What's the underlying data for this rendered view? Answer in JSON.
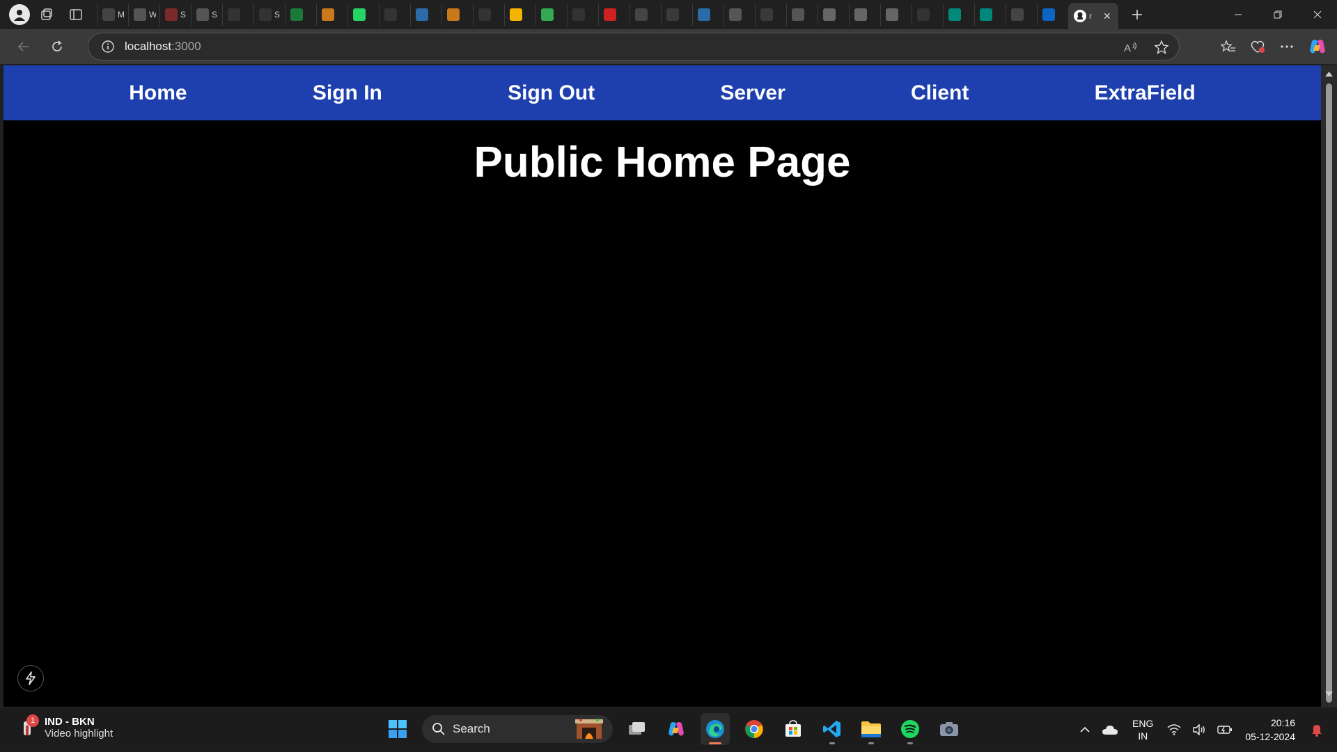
{
  "browser": {
    "tabs": [
      {
        "icon": "medium-icon",
        "title": "M",
        "color": "#444444"
      },
      {
        "icon": "crown-icon",
        "title": "W",
        "color": "#555555"
      },
      {
        "icon": "crown-icon",
        "title": "S",
        "color": "#7a2a2a"
      },
      {
        "icon": "crown-icon",
        "title": "S",
        "color": "#555555"
      },
      {
        "icon": "github-icon",
        "title": "",
        "color": "#333333"
      },
      {
        "icon": "github-icon",
        "title": "S",
        "color": "#333333"
      },
      {
        "icon": "leaf-icon",
        "title": "",
        "color": "#1b7a3a"
      },
      {
        "icon": "infinity-icon",
        "title": "",
        "color": "#c87a1a"
      },
      {
        "icon": "whatsapp-icon",
        "title": "",
        "color": "#25d366"
      },
      {
        "icon": "github-icon",
        "title": "",
        "color": "#333333"
      },
      {
        "icon": "planner-icon",
        "title": "",
        "color": "#2b6ca8"
      },
      {
        "icon": "infinity-icon",
        "title": "",
        "color": "#c87a1a"
      },
      {
        "icon": "github-icon",
        "title": "",
        "color": "#333333"
      },
      {
        "icon": "google-drive-icon",
        "title": "",
        "color": "#f4b400"
      },
      {
        "icon": "google-drive-icon",
        "title": "",
        "color": "#34a853"
      },
      {
        "icon": "github-icon",
        "title": "",
        "color": "#333333"
      },
      {
        "icon": "opera-icon",
        "title": "",
        "color": "#cc2222"
      },
      {
        "icon": "notion-icon",
        "title": "",
        "color": "#444444"
      },
      {
        "icon": "search-icon",
        "title": "",
        "color": "#3a3a3a"
      },
      {
        "icon": "jira-icon",
        "title": "",
        "color": "#2b6ca8"
      },
      {
        "icon": "copilot-icon",
        "title": "",
        "color": "#555555"
      },
      {
        "icon": "search-icon",
        "title": "",
        "color": "#3a3a3a"
      },
      {
        "icon": "copilot-icon",
        "title": "",
        "color": "#555555"
      },
      {
        "icon": "thumbnail-icon",
        "title": "",
        "color": "#666666"
      },
      {
        "icon": "thumbnail-icon",
        "title": "",
        "color": "#666666"
      },
      {
        "icon": "thumbnail-icon",
        "title": "",
        "color": "#666666"
      },
      {
        "icon": "github-icon",
        "title": "",
        "color": "#333333"
      },
      {
        "icon": "meet-icon",
        "title": "",
        "color": "#00897b"
      },
      {
        "icon": "meet-icon",
        "title": "",
        "color": "#00897b"
      },
      {
        "icon": "openai-icon",
        "title": "",
        "color": "#444444"
      },
      {
        "icon": "linkedin-icon",
        "title": "",
        "color": "#0a66c2"
      }
    ],
    "active_tab": {
      "icon": "github-icon",
      "title": "r"
    },
    "url_host": "localhost",
    "url_port": ":3000"
  },
  "site": {
    "nav": [
      "Home",
      "Sign In",
      "Sign Out",
      "Server",
      "Client",
      "ExtraField"
    ],
    "heading": "Public Home Page",
    "brand_color": "#1e40af"
  },
  "taskbar": {
    "widget_badge": "1",
    "widget_title": "IND - BKN",
    "widget_subtitle": "Video highlight",
    "search_placeholder": "Search",
    "lang_top": "ENG",
    "lang_bottom": "IN",
    "time": "20:16",
    "date": "05-12-2024"
  }
}
